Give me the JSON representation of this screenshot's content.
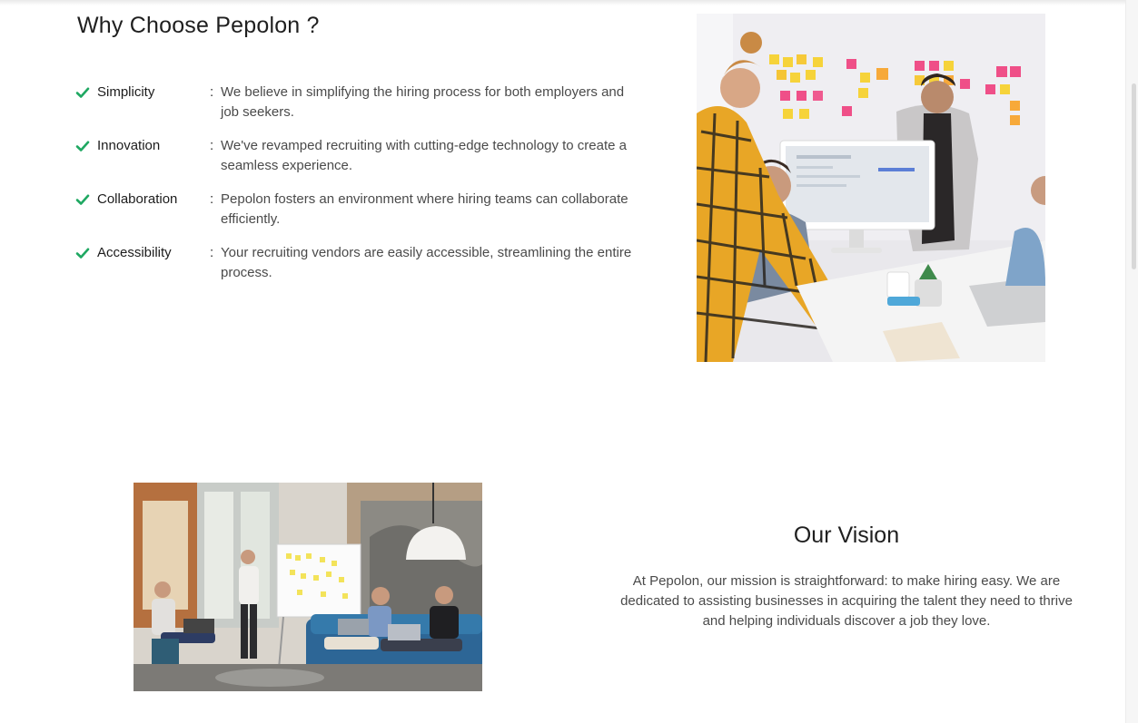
{
  "why_section": {
    "title": "Why Choose Pepolon ?",
    "features": [
      {
        "name": "Simplicity",
        "separator": ":",
        "description": "We believe in simplifying the hiring process for both employers and job seekers."
      },
      {
        "name": "Innovation",
        "separator": ":",
        "description": "We've revamped recruiting with cutting-edge technology to create a seamless experience."
      },
      {
        "name": "Collaboration",
        "separator": ":",
        "description": "Pepolon fosters an environment where hiring teams can collaborate efficiently."
      },
      {
        "name": "Accessibility",
        "separator": ":",
        "description": "Your recruiting vendors are easily accessible, streamlining the entire process."
      }
    ],
    "check_icon": "checkmark-icon",
    "accent_color": "#1fa862"
  },
  "vision_section": {
    "title": "Our Vision",
    "text": "At Pepolon, our mission is straightforward: to make hiring easy. We are dedicated to assisting businesses in acquiring the talent they need to thrive and helping individuals discover a job they love."
  },
  "colors": {
    "background": "#ffffff",
    "heading": "#1f1f1f",
    "body_text": "#4a4a4a"
  }
}
